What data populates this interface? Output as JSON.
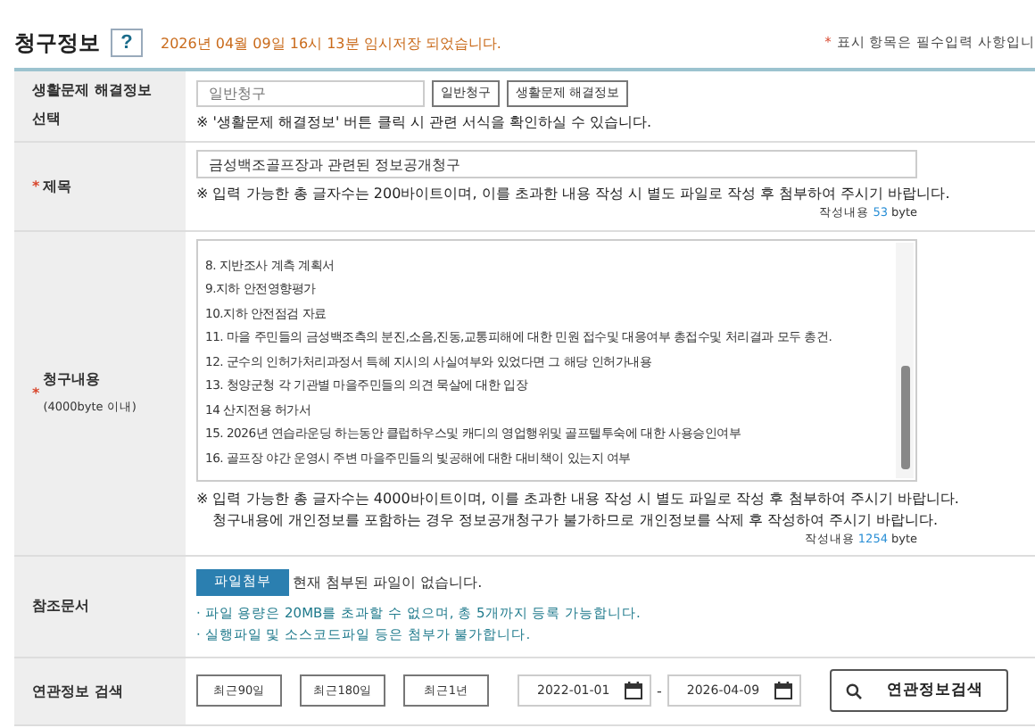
{
  "header": {
    "title": "청구정보",
    "help_label": "?",
    "saved_notice": "2026년 04월 09일 16시 13분 임시저장 되었습니다.",
    "required_mark": "*",
    "required_note": "표시 항목은 필수입력 사항입니"
  },
  "rows": [
    {
      "kind": "type_select",
      "label": "생활문제 해결정보 선택",
      "placeholder": "일반청구",
      "buttons": [
        "일반청구",
        "생활문제 해결정보"
      ],
      "note": "※ '생활문제 해결정보' 버튼 클릭 시 관련 서식을 확인하실 수 있습니다."
    },
    {
      "kind": "title",
      "required_mark": "*",
      "label": "제목",
      "value": "금성백조골프장과 관련된 정보공개청구",
      "note": "※ 입력 가능한 총 글자수는 200바이트이며, 이를 초과한 내용 작성 시 별도 파일로 작성 후 첨부하여 주시기 바랍니다.",
      "counter": {
        "label": "작성내용",
        "count": "53",
        "unit": "byte"
      }
    },
    {
      "kind": "content",
      "required_mark": "*",
      "label": "청구내용",
      "sublabel": "(4000byte 이내)",
      "lines": [
        "8. 지반조사 계측 계획서",
        "9.지하 안전영향평가",
        "10.지하 안전점검 자료",
        "11. 마을 주민들의 금성백조측의 분진,소음,진동,교통피해에 대한 민원 접수및 대응여부 총접수및 처리결과 모두 총건.",
        "12. 군수의 인허가처리과정서 특혜 지시의 사실여부와 있었다면 그 해당 인허가내용",
        "13. 청양군청 각 기관별 마을주민들의 의견 묵살에 대한 입장",
        "14 산지전용 허가서",
        "15. 2026년 연습라운딩 하는동안 클럽하우스및 캐디의 영업행위및 골프텔투숙에 대한 사용승인여부",
        "16. 골프장 야간 운영시 주변 마을주민들의 빛공해에 대한 대비책이 있는지 여부"
      ],
      "notes": [
        "※ 입력 가능한 총 글자수는 4000바이트이며, 이를 초과한 내용 작성 시 별도 파일로 작성 후 첨부하여 주시기 바랍니다.",
        "청구내용에 개인정보를 포함하는 경우 정보공개청구가 불가하므로 개인정보를 삭제 후 작성하여 주시기 바랍니다."
      ],
      "counter": {
        "label": "작성내용",
        "count": "1254",
        "unit": "byte"
      }
    },
    {
      "kind": "attachment",
      "label": "참조문서",
      "button": "파일첨부",
      "status": "현재 첨부된 파일이 없습니다.",
      "hints": [
        "· 파일 용량은 20MB를 초과할 수 없으며, 총 5개까지 등록 가능합니다.",
        "· 실행파일 및 소스코드파일 등은 첨부가 불가합니다."
      ]
    },
    {
      "kind": "search",
      "label": "연관정보 검색",
      "period_buttons": [
        "최근90일",
        "최근180일",
        "최근1년"
      ],
      "date_from": "2022-01-01",
      "date_separator": "-",
      "date_to": "2026-04-09",
      "search_button": "연관정보검색"
    }
  ]
}
